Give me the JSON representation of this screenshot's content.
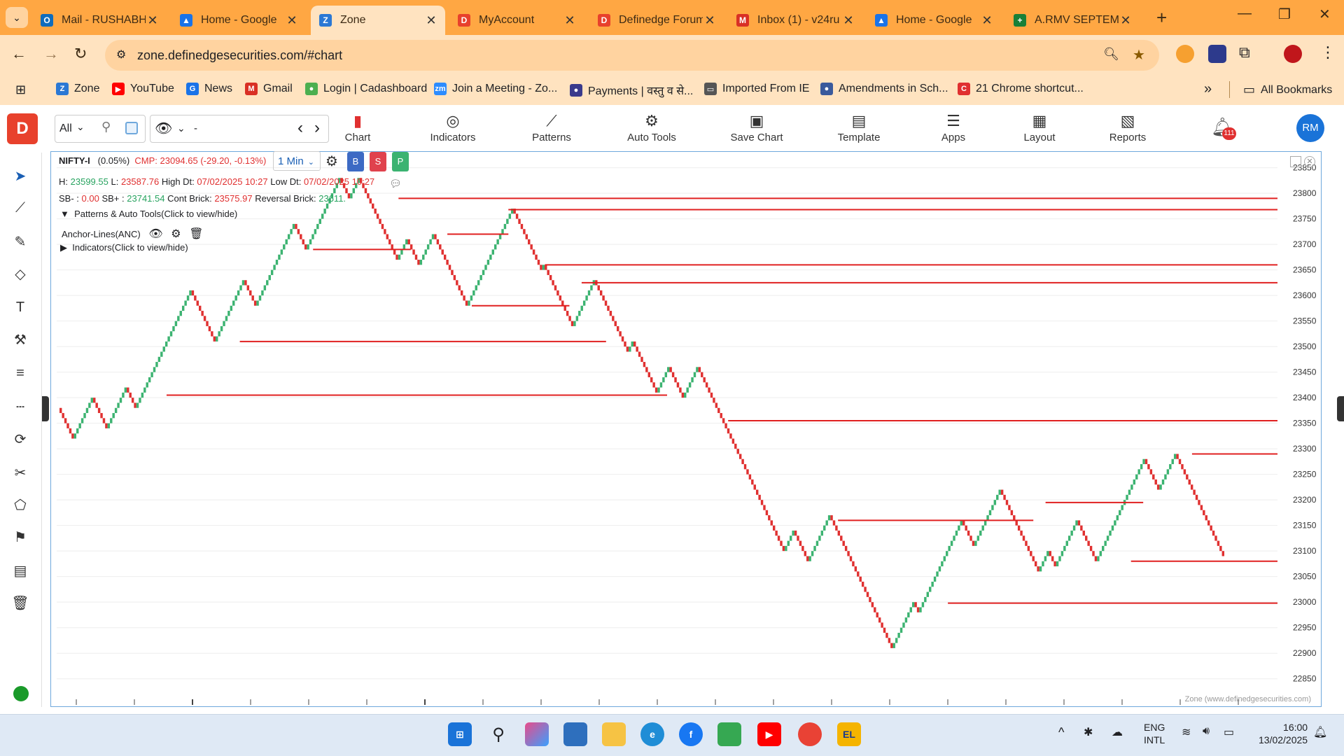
{
  "browser": {
    "tabs": [
      {
        "title": "Mail - RUSHABH",
        "icon": "outlook-icon",
        "color": "#0f6cbd",
        "glyph": "O"
      },
      {
        "title": "Home - Google",
        "icon": "google-drive-icon",
        "color": "#1a73e8",
        "glyph": "▲"
      },
      {
        "title": "Zone",
        "icon": "zone-icon",
        "color": "#2b78d4",
        "glyph": "Z",
        "active": true
      },
      {
        "title": "MyAccount",
        "icon": "definedge-icon",
        "color": "#e8412c",
        "glyph": "D"
      },
      {
        "title": "Definedge Forum",
        "icon": "definedge-icon",
        "color": "#e8412c",
        "glyph": "D"
      },
      {
        "title": "Inbox (1) - v24ru",
        "icon": "gmail-icon",
        "color": "#d93025",
        "glyph": "M"
      },
      {
        "title": "Home - Google",
        "icon": "google-drive-icon",
        "color": "#1a73e8",
        "glyph": "▲"
      },
      {
        "title": "A.RMV SEPTEMB",
        "icon": "sheets-icon",
        "color": "#188038",
        "glyph": "+"
      }
    ],
    "url": "zone.definedgesecurities.com/#chart",
    "bookmarks": [
      {
        "label": "Zone",
        "color": "#2b78d4",
        "glyph": "Z"
      },
      {
        "label": "YouTube",
        "color": "#ff0000",
        "glyph": "▶"
      },
      {
        "label": "News",
        "color": "#1a73e8",
        "glyph": "G"
      },
      {
        "label": "Gmail",
        "color": "#d93025",
        "glyph": "M"
      },
      {
        "label": "Login | Cadashboard",
        "color": "#4caf50",
        "glyph": "●"
      },
      {
        "label": "Join a Meeting - Zo...",
        "color": "#2d8cff",
        "glyph": "zm"
      },
      {
        "label": "Payments | वस्तु व से...",
        "color": "#3a3a8c",
        "glyph": "●"
      },
      {
        "label": "Imported From IE",
        "color": "#555555",
        "glyph": "▭"
      },
      {
        "label": "Amendments in Sch...",
        "color": "#3a5a9c",
        "glyph": "●"
      },
      {
        "label": "21 Chrome shortcut...",
        "color": "#e03030",
        "glyph": "C"
      }
    ],
    "all_bookmarks": "All Bookmarks"
  },
  "toolbar": {
    "filter": "All",
    "timeframe_placeholder": "-",
    "buttons": [
      {
        "label": "Chart",
        "icon": "candlestick-icon"
      },
      {
        "label": "Indicators",
        "icon": "indicators-icon"
      },
      {
        "label": "Patterns",
        "icon": "patterns-icon"
      },
      {
        "label": "Auto Tools",
        "icon": "auto-tools-icon"
      },
      {
        "label": "Save Chart",
        "icon": "save-icon"
      },
      {
        "label": "Template",
        "icon": "template-icon"
      },
      {
        "label": "Apps",
        "icon": "apps-icon"
      },
      {
        "label": "Layout",
        "icon": "layout-icon"
      },
      {
        "label": "Reports",
        "icon": "reports-icon"
      }
    ],
    "notifications": "111",
    "avatar": "RM"
  },
  "chart_info": {
    "symbol": "NIFTY-I",
    "change_pct": "(0.05%)",
    "cmp": "CMP: 23094.65 (-29.20, -0.13%)",
    "interval": "1 Min",
    "buy": "B",
    "sell": "S",
    "p": "P",
    "h_label": "H:",
    "h": "23599.55",
    "l_label": "L:",
    "l": "23587.76",
    "high_dt_label": "High Dt:",
    "high_dt": "07/02/2025 10:27",
    "low_dt_label": "Low Dt:",
    "low_dt": "07/02/2025 10:27",
    "sb_minus_label": "SB- :",
    "sb_minus": "0.00",
    "sb_plus_label": "SB+ :",
    "sb_plus": "23741.54",
    "cont_brick_label": "Cont Brick:",
    "cont_brick": "23575.97",
    "reversal_brick_label": "Reversal Brick:",
    "reversal_brick": "23611.",
    "patterns_toggle": "Patterns & Auto Tools(Click to view/hide)",
    "anchor_lines": "Anchor-Lines(ANC)",
    "indicators_toggle": "Indicators(Click to view/hide)",
    "watermark": "Zone (www.definedgesecurities.com)"
  },
  "chart_data": {
    "type": "renko-line",
    "y_ticks": [
      23850,
      23800,
      23750,
      23700,
      23650,
      23600,
      23550,
      23500,
      23450,
      23400,
      23350,
      23300,
      23250,
      23200,
      23150,
      23100,
      23050,
      23000,
      22950,
      22900,
      22850
    ],
    "ylim": [
      22840,
      23870
    ],
    "up_color": "#3cb371",
    "down_color": "#e03030",
    "anchor_color": "#e02020",
    "pivots": [
      23380,
      23320,
      23400,
      23340,
      23420,
      23380,
      23610,
      23510,
      23630,
      23580,
      23740,
      23690,
      23830,
      23790,
      23830,
      23750,
      23670,
      23710,
      23660,
      23720,
      23580,
      23770,
      23650,
      23660,
      23540,
      23630,
      23490,
      23510,
      23410,
      23460,
      23400,
      23460,
      23360,
      23330,
      23100,
      23140,
      23080,
      23170,
      22910,
      23000,
      22980,
      23160,
      23110,
      23160,
      23220,
      23060,
      23100,
      23070,
      23160,
      23080,
      23280,
      23220,
      23290,
      23090
    ],
    "anchors": [
      {
        "y": 23790,
        "from": 0.28,
        "to": 1
      },
      {
        "y": 23768,
        "from": 0.37,
        "to": 1
      },
      {
        "y": 23660,
        "from": 0.4,
        "to": 1
      },
      {
        "y": 23625,
        "from": 0.43,
        "to": 1
      },
      {
        "y": 23720,
        "from": 0.32,
        "to": 0.37
      },
      {
        "y": 23690,
        "from": 0.21,
        "to": 0.29
      },
      {
        "y": 23580,
        "from": 0.34,
        "to": 0.42
      },
      {
        "y": 23510,
        "from": 0.15,
        "to": 0.45
      },
      {
        "y": 23405,
        "from": 0.09,
        "to": 0.5
      },
      {
        "y": 23355,
        "from": 0.55,
        "to": 1
      },
      {
        "y": 23290,
        "from": 0.93,
        "to": 1
      },
      {
        "y": 23195,
        "from": 0.81,
        "to": 0.89
      },
      {
        "y": 23160,
        "from": 0.64,
        "to": 0.8
      },
      {
        "y": 23080,
        "from": 0.88,
        "to": 1
      },
      {
        "y": 22998,
        "from": 0.73,
        "to": 1
      }
    ]
  },
  "lefttools": [
    "cursor-icon",
    "trendline-icon",
    "brush-icon",
    "shapes-icon",
    "text-icon",
    "measure-icon",
    "parallel-channel-icon",
    "ruler-icon",
    "magnet-icon",
    "pattern-icon",
    "polygon-icon",
    "flag-icon",
    "layers-icon",
    "trash-icon"
  ],
  "taskbar": {
    "lang_top": "ENG",
    "lang_bottom": "INTL",
    "time": "16:00",
    "date": "13/02/2025",
    "chrome_badge": ""
  }
}
